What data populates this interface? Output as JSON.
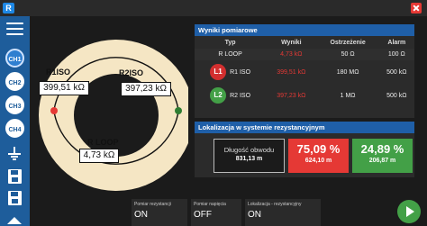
{
  "app": {
    "icon_letter": "R"
  },
  "sidebar": {
    "channels": [
      {
        "label": "CH1",
        "active": true
      },
      {
        "label": "CH2",
        "active": false
      },
      {
        "label": "CH3",
        "active": false
      },
      {
        "label": "CH4",
        "active": false
      }
    ]
  },
  "diagram": {
    "r1_label": "R1ISO",
    "r1_value": "399,51 kΩ",
    "r2_label": "R2ISO",
    "r2_value": "397,23 kΩ",
    "loop_label": "R LOOP",
    "loop_value": "4,73 kΩ"
  },
  "results": {
    "title": "Wyniki pomiarowe",
    "headers": [
      "Typ",
      "Wyniki",
      "Ostrzeżenie",
      "Alarm"
    ],
    "row_loop": {
      "type": "R LOOP",
      "result": "4,73 kΩ",
      "warning": "50 Ω",
      "alarm": "100 Ω"
    },
    "row_l1": {
      "badge": "L1",
      "type": "R1 ISO",
      "result": "399,51 kΩ",
      "warning": "180 MΩ",
      "alarm": "500 kΩ"
    },
    "row_l2": {
      "badge": "L2",
      "type": "R2 ISO",
      "result": "397,23 kΩ",
      "warning": "1 MΩ",
      "alarm": "500 kΩ"
    }
  },
  "localization": {
    "title": "Lokalizacja w systemie rezystancyjnym",
    "length_caption": "Długość obwodu",
    "length_value": "831,13 m",
    "red_percent": "75,09 %",
    "red_distance": "624,10 m",
    "green_percent": "24,89 %",
    "green_distance": "206,87 m"
  },
  "status_bar": [
    {
      "label": "Pomiar rezystancji",
      "value": "ON"
    },
    {
      "label": "Pomiar napięcia",
      "value": "OFF"
    },
    {
      "label": "Lokalizacja - rezystancyjny",
      "value": "ON"
    }
  ],
  "colors": {
    "accent": "#1f5fa8",
    "sidebar": "#1e5d9b",
    "alarm_red": "#e53935",
    "ok_green": "#43a047",
    "ring": "#f5e6c4"
  }
}
